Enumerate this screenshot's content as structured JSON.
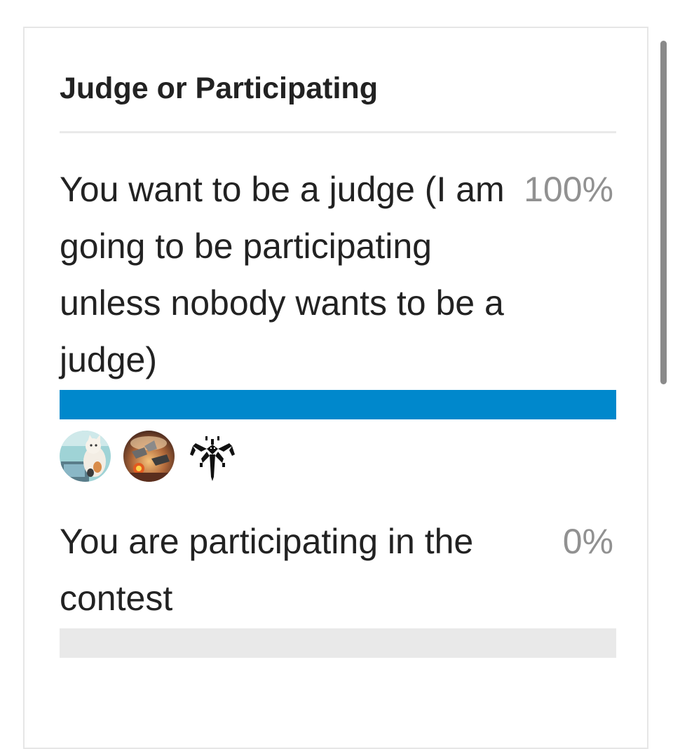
{
  "poll": {
    "title": "Judge or Participating",
    "accent_color": "#0088cc",
    "track_color": "#e9e9e9",
    "options": [
      {
        "label": "You want to be a judge (I am going to be participating unless nobody wants to be a judge)",
        "percent_text": "100%",
        "percent": 100,
        "voters": [
          {
            "icon": "cat-avatar"
          },
          {
            "icon": "battle-scene-avatar"
          },
          {
            "icon": "dark-creature-avatar"
          }
        ]
      },
      {
        "label": "You are participating in the contest",
        "percent_text": "0%",
        "percent": 0,
        "voters": []
      }
    ]
  }
}
